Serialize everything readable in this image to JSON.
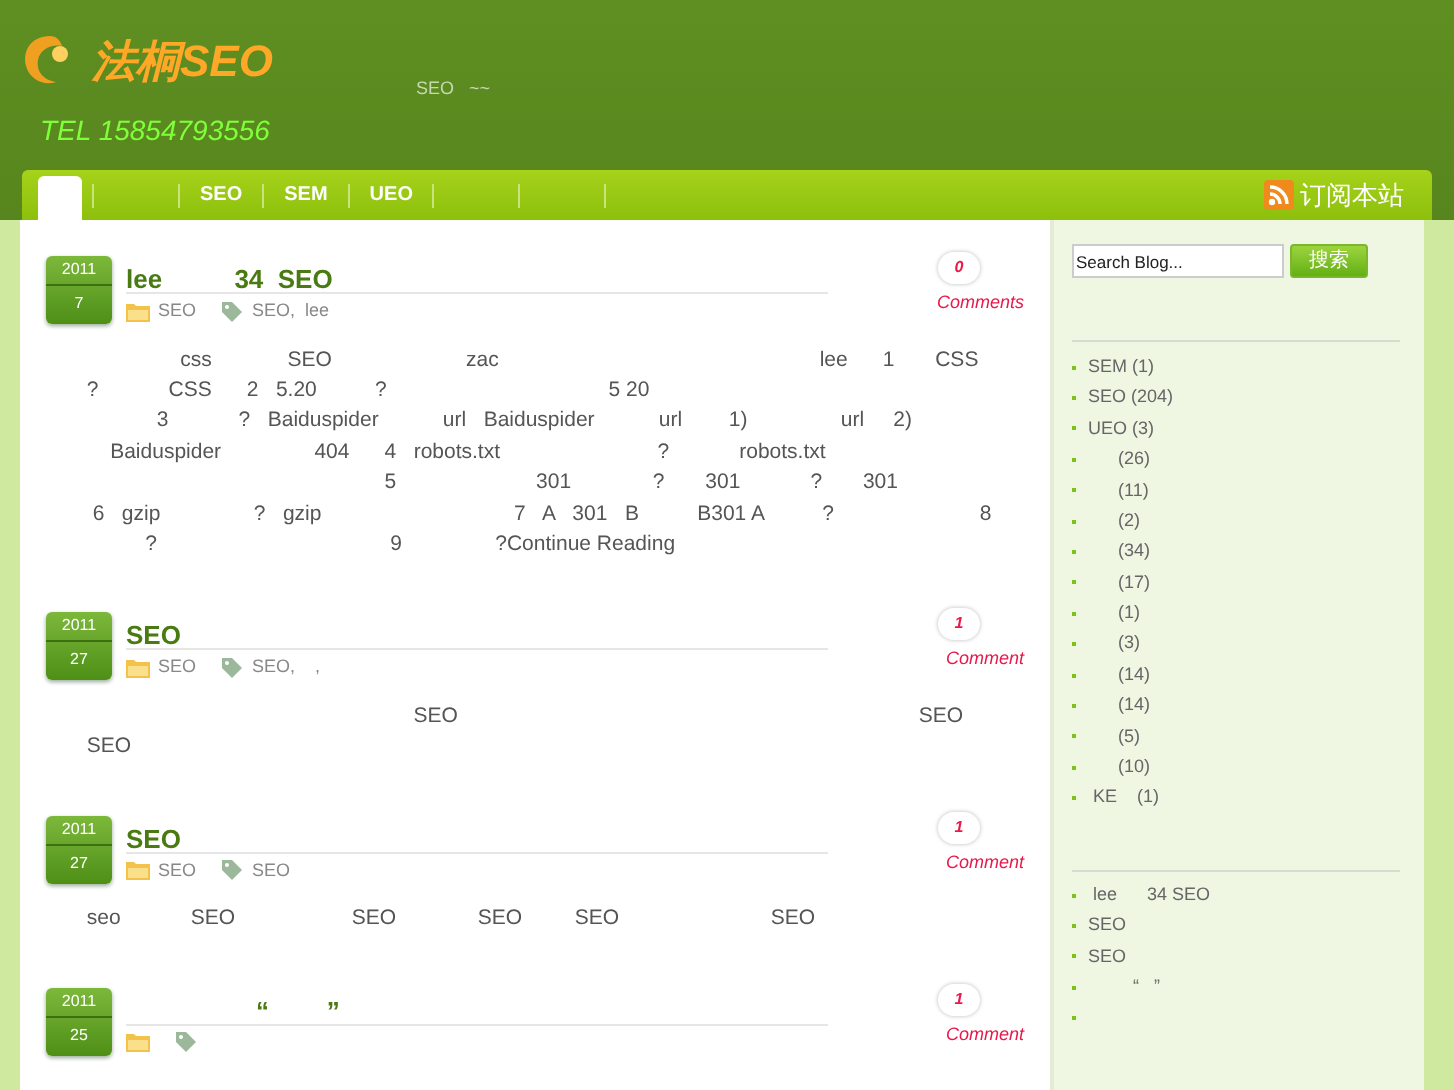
{
  "header": {
    "logo_title": "法桐SEO",
    "phone": "TEL 15854793556",
    "tagline": "SEO   ~~"
  },
  "nav": {
    "items": [
      {
        "kind": "home",
        "selected": true
      },
      {
        "kind": "link",
        "label": "SEO",
        "selected": false
      },
      {
        "kind": "link",
        "label": "SEM",
        "selected": false
      },
      {
        "kind": "link",
        "label": "UEO",
        "selected": false
      }
    ],
    "subscribe": "订阅本站"
  },
  "posts": [
    {
      "year": "2011",
      "day": "7",
      "title": "lee          34  SEO",
      "category": "SEO",
      "tags": "SEO,  lee",
      "comments_count": "0",
      "comments_label": "Comments",
      "body": [
        "                       css             SEO                       zac                                                       lee      1       CSS",
        "       ?            CSS      2   5.20          ?                                      5 20",
        "                   3            ?   Baiduspider           url   Baiduspider           url        1)                url     2)",
        "           Baiduspider                404      4   robots.txt                           ?            robots.txt",
        "                                                          5                        301              ?       301            ?       301",
        "        6   gzip                ?   gzip                                 7   A   301   B          B301 A          ?                         8",
        "                 ?                                        9                ?Continue Reading"
      ]
    },
    {
      "year": "2011",
      "day": "27",
      "title": "SEO",
      "category": "SEO",
      "tags": "SEO,    ,",
      "comments_count": "1",
      "comments_label": "Comment",
      "body": [
        "                                                               SEO                                                                               SEO",
        "       SEO"
      ]
    },
    {
      "year": "2011",
      "day": "27",
      "title": "SEO",
      "category": "SEO",
      "tags": "SEO",
      "comments_count": "1",
      "comments_label": "Comment",
      "body": [
        "       seo            SEO                    SEO              SEO         SEO                          SEO"
      ]
    },
    {
      "year": "2011",
      "day": "25",
      "title": "                  “        ”",
      "comments_count": "1",
      "comments_label": "Comment"
    }
  ],
  "sidebar": {
    "search": {
      "value": "Search Blog...",
      "button": "搜索"
    },
    "categories": [
      "SEM (1)",
      "SEO (204)",
      "UEO (3)",
      "      (26)",
      "      (11)",
      "      (2)",
      "      (34)",
      "      (17)",
      "      (1)",
      "      (3)",
      "      (14)",
      "      (14)",
      "      (5)",
      "      (10)",
      " KE    (1)"
    ],
    "recent_posts": [
      " lee      34 SEO",
      "SEO",
      "SEO",
      "         “   ”"
    ]
  }
}
